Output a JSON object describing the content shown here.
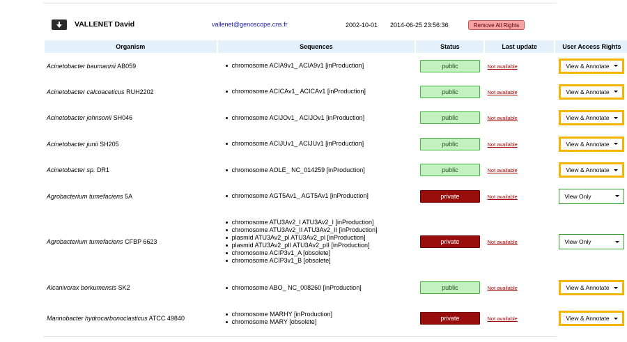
{
  "user": {
    "name": "VALLENET David",
    "email": "vallenet@genoscope.cns.fr",
    "date_created": "2002-10-01",
    "last_login": "2014-06-25 23:56:36",
    "remove_all_label": "Remove All Rights",
    "toggle_icon": "arrow-down-icon"
  },
  "table": {
    "headers": {
      "organism": "Organism",
      "sequences": "Sequences",
      "status": "Status",
      "last_update": "Last update",
      "rights": "User Access Rights"
    },
    "rows": [
      {
        "genus_species": "Acinetobacter baumannii",
        "strain": "AB059",
        "sequences": [
          "chromosome ACIA9v1_ ACIA9v1 [inProduction]"
        ],
        "status": "public",
        "last_update": "Not available",
        "rights": "View & Annotate"
      },
      {
        "genus_species": "Acinetobacter calcoaceticus",
        "strain": "RUH2202",
        "sequences": [
          "chromosome ACICAv1_ ACICAv1 [inProduction]"
        ],
        "status": "public",
        "last_update": "Not available",
        "rights": "View & Annotate"
      },
      {
        "genus_species": "Acinetobacter johnsonii",
        "strain": "SH046",
        "sequences": [
          "chromosome ACIJOv1_ ACIJOv1 [inProduction]"
        ],
        "status": "public",
        "last_update": "Not available",
        "rights": "View & Annotate"
      },
      {
        "genus_species": "Acinetobacter junii",
        "strain": "SH205",
        "sequences": [
          "chromosome ACIJUv1_ ACIJUv1 [inProduction]"
        ],
        "status": "public",
        "last_update": "Not available",
        "rights": "View & Annotate"
      },
      {
        "genus_species": "Acinetobacter sp.",
        "strain": "DR1",
        "sequences": [
          "chromosome AOLE_ NC_014259 [inProduction]"
        ],
        "status": "public",
        "last_update": "Not available",
        "rights": "View & Annotate"
      },
      {
        "genus_species": "Agrobacterium tumefaciens",
        "strain": "5A",
        "sequences": [
          "chromosome AGT5Av1_ AGT5Av1 [inProduction]"
        ],
        "status": "private",
        "last_update": "Not available",
        "rights": "View Only"
      },
      {
        "genus_species": "Agrobacterium tumefaciens",
        "strain": "CFBP 6623",
        "sequences": [
          "chromosome ATU3Av2_I ATU3Av2_I [inProduction]",
          "chromosome ATU3Av2_II ATU3Av2_II [inProduction]",
          "plasmid ATU3Av2_pl ATU3Av2_pl [inProduction]",
          "plasmid ATU3Av2_pII ATU3Av2_pII [inProduction]",
          "chromosome ACIP3v1_A [obsolete]",
          "chromosome ACIP3v1_B [obsolete]"
        ],
        "status": "private",
        "last_update": "Not available",
        "rights": "View Only"
      },
      {
        "genus_species": "Alcanivorax borkumensis",
        "strain": "SK2",
        "sequences": [
          "chromosome ABO_ NC_008260 [inProduction]"
        ],
        "status": "public",
        "last_update": "Not available",
        "rights": "View & Annotate"
      },
      {
        "genus_species": "Marinobacter hydrocarbonoclasticus",
        "strain": "ATCC 49840",
        "sequences": [
          "chromosome MARHY [inProduction]",
          "chromosome MARY [obsolete]"
        ],
        "status": "private",
        "last_update": "Not available",
        "rights": "View & Annotate"
      }
    ]
  },
  "colors": {
    "header_bg": "#e4f1fb",
    "public_bg": "#c3f2c0",
    "public_border": "#3fb53a",
    "private_bg": "#990d0d",
    "annotate_border": "#f5b400",
    "viewonly_border": "#2fa22a",
    "link": "#a30000",
    "remove_bg": "#f6a2a2"
  }
}
